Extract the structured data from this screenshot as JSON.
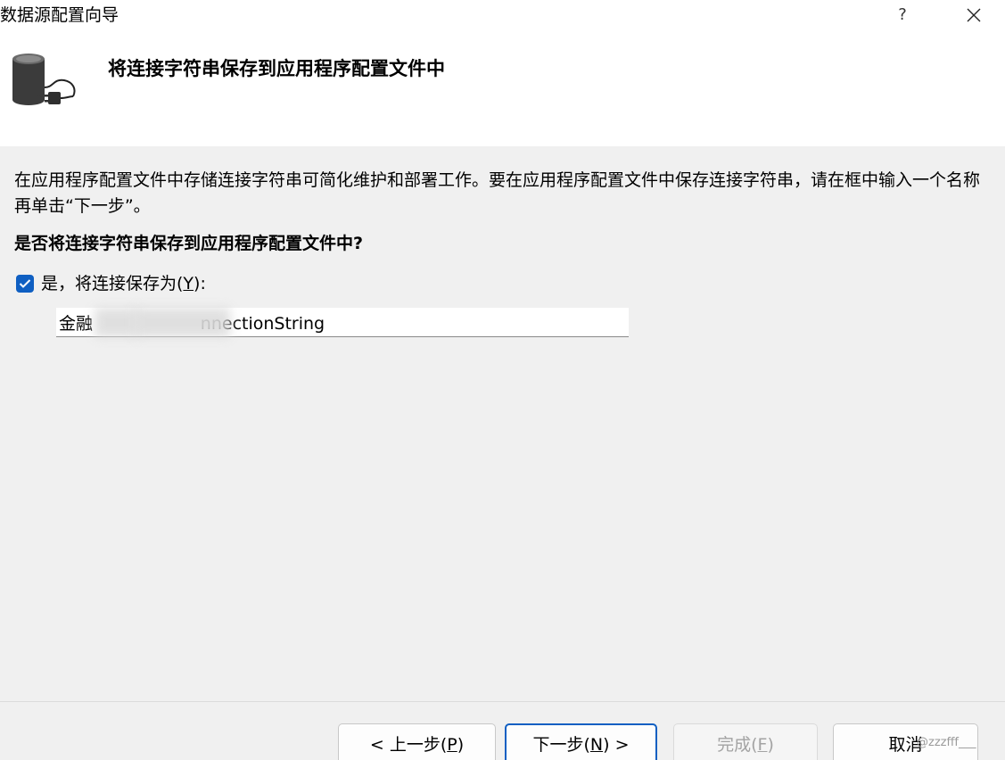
{
  "window": {
    "title": "数据源配置向导",
    "help_label": "?"
  },
  "header": {
    "title": "将连接字符串保存到应用程序配置文件中",
    "icon": "database-plug-icon"
  },
  "content": {
    "description": "在应用程序配置文件中存储连接字符串可简化维护和部署工作。要在应用程序配置文件中保存连接字符串，请在框中输入一个名称再单击“下一步”。",
    "question": "是否将连接字符串保存到应用程序配置文件中?",
    "save_checkbox": {
      "checked": true,
      "label_prefix": "是，将连接保存为(",
      "label_mnemonic": "Y",
      "label_suffix": "):"
    },
    "connection_name": {
      "value": "金融                    nnectionString"
    }
  },
  "footer": {
    "back": {
      "prefix": "< 上一步(",
      "mnemonic": "P",
      "suffix": ")"
    },
    "next": {
      "prefix": "下一步(",
      "mnemonic": "N",
      "suffix": ") >"
    },
    "finish": {
      "prefix": "完成(",
      "mnemonic": "F",
      "suffix": ")"
    },
    "cancel": {
      "label": "取消"
    }
  },
  "watermark": "@zzzfff___",
  "colors": {
    "accent": "#0f5fc2",
    "background": "#f0f0f0",
    "header_background": "#ffffff",
    "disabled_text": "#a3a3a3"
  }
}
